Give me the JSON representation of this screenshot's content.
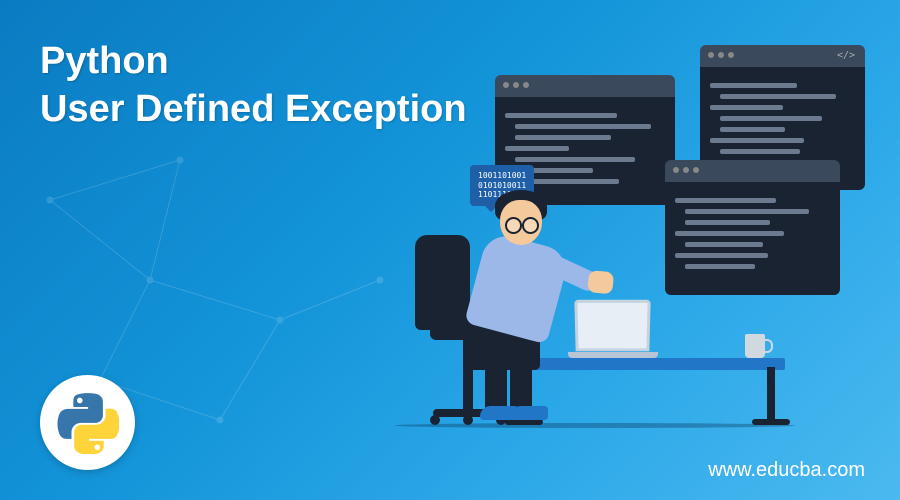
{
  "title_line1": "Python",
  "title_line2": "User Defined Exception",
  "url": "www.educba.com",
  "binary_text": "1001101001\n0101010011\n1101110011",
  "colors": {
    "bg_gradient_start": "#0a7bc2",
    "bg_gradient_end": "#4bb9ef",
    "code_window": "#1a2332",
    "desk": "#2176c7",
    "shirt": "#9bb8e8",
    "skin": "#f4c99b"
  }
}
